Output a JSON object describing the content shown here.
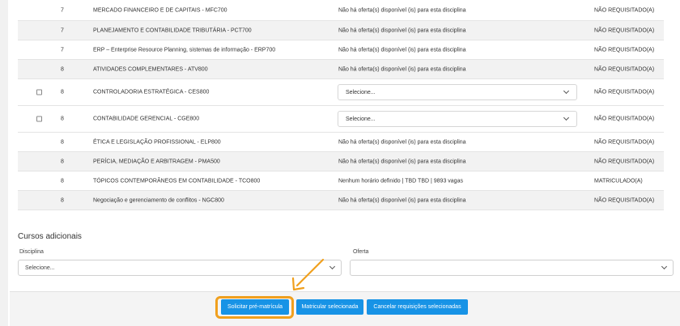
{
  "table": {
    "rows": [
      {
        "sem": "7",
        "disciplina": "MERCADO FINANCEIRO E DE CAPITAIS - MFC700",
        "oferta": "Não há oferta(s) disponível (is) para esta disciplina",
        "status": "NÃO REQUISITADO(A)",
        "checkbox": false,
        "select": false
      },
      {
        "sem": "7",
        "disciplina": "PLANEJAMENTO E CONTABILIDADE TRIBUTÁRIA - PCT700",
        "oferta": "Não há oferta(s) disponível (is) para esta disciplina",
        "status": "NÃO REQUISITADO(A)",
        "checkbox": false,
        "select": false
      },
      {
        "sem": "7",
        "disciplina": "ERP – Enterprise Resource Planning, sistemas de informação - ERP700",
        "oferta": "Não há oferta(s) disponível (is) para esta disciplina",
        "status": "NÃO REQUISITADO(A)",
        "checkbox": false,
        "select": false
      },
      {
        "sem": "8",
        "disciplina": "ATIVIDADES COMPLEMENTARES - ATV800",
        "oferta": "Não há oferta(s) disponível (is) para esta disciplina",
        "status": "NÃO REQUISITADO(A)",
        "checkbox": false,
        "select": false
      },
      {
        "sem": "8",
        "disciplina": "CONTROLADORIA ESTRATÉGICA - CES800",
        "oferta": "Selecione...",
        "status": "NÃO REQUISITADO(A)",
        "checkbox": true,
        "select": true
      },
      {
        "sem": "8",
        "disciplina": "CONTABILIDADE GERENCIAL - CGE800",
        "oferta": "Selecione...",
        "status": "NÃO REQUISITADO(A)",
        "checkbox": true,
        "select": true
      },
      {
        "sem": "8",
        "disciplina": "ÉTICA E LEGISLAÇÃO PROFISSIONAL - ELP800",
        "oferta": "Não há oferta(s) disponível (is) para esta disciplina",
        "status": "NÃO REQUISITADO(A)",
        "checkbox": false,
        "select": false
      },
      {
        "sem": "8",
        "disciplina": "PERÍCIA, MEDIAÇÃO E ARBITRAGEM - PMA500",
        "oferta": "Não há oferta(s) disponível (is) para esta disciplina",
        "status": "NÃO REQUISITADO(A)",
        "checkbox": false,
        "select": false
      },
      {
        "sem": "8",
        "disciplina": "TÓPICOS CONTEMPORÂNEOS EM CONTABILIDADE - TCO800",
        "oferta": "Nenhum horário definido | TBD TBD | 9893 vagas",
        "status": "MATRICULADO(A)",
        "checkbox": false,
        "select": false
      },
      {
        "sem": "8",
        "disciplina": "Negociação e gerenciamento de conflitos - NGC800",
        "oferta": "Não há oferta(s) disponível (is) para esta disciplina",
        "status": "NÃO REQUISITADO(A)",
        "checkbox": false,
        "select": false
      }
    ]
  },
  "cursos_adicionais": {
    "title": "Cursos adicionais",
    "disciplina_label": "Disciplina",
    "disciplina_value": "Selecione...",
    "oferta_label": "Oferta",
    "oferta_value": ""
  },
  "footer": {
    "btn_pre": "Solicitar pré-matrícula",
    "btn_matricular": "Matricular selecionada",
    "btn_cancelar": "Cancelar requisições selecionadas"
  },
  "colors": {
    "accent": "#1793e6",
    "highlight": "#f0a01e"
  }
}
